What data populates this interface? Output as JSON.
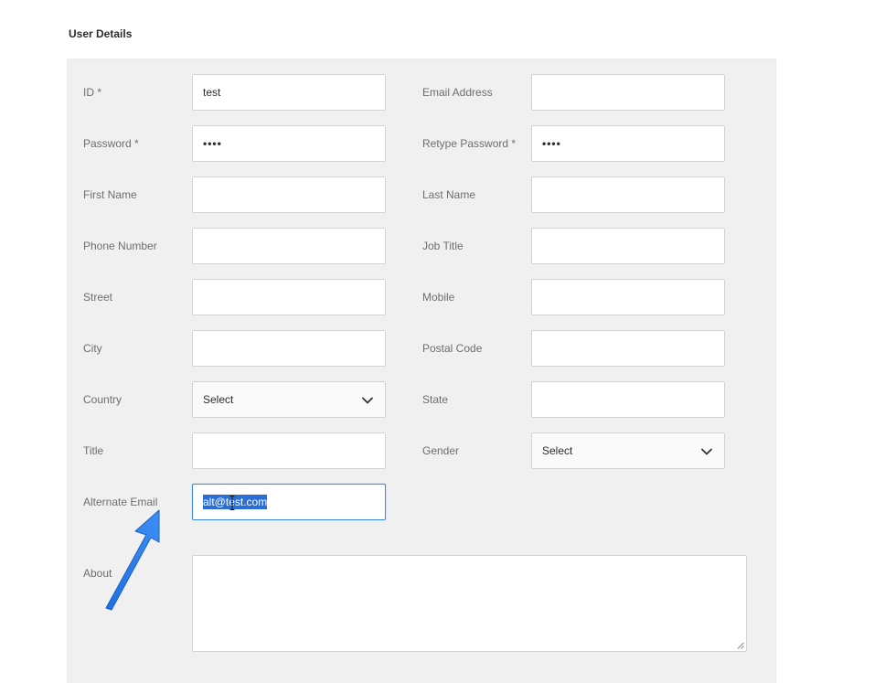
{
  "section": {
    "title": "User Details"
  },
  "fields": {
    "id": {
      "label": "ID *",
      "value": "test"
    },
    "email": {
      "label": "Email Address",
      "value": ""
    },
    "password": {
      "label": "Password *",
      "value": "••••"
    },
    "retype_password": {
      "label": "Retype Password *",
      "value": "••••"
    },
    "first_name": {
      "label": "First Name",
      "value": ""
    },
    "last_name": {
      "label": "Last Name",
      "value": ""
    },
    "phone": {
      "label": "Phone Number",
      "value": ""
    },
    "job_title": {
      "label": "Job Title",
      "value": ""
    },
    "street": {
      "label": "Street",
      "value": ""
    },
    "mobile": {
      "label": "Mobile",
      "value": ""
    },
    "city": {
      "label": "City",
      "value": ""
    },
    "postal_code": {
      "label": "Postal Code",
      "value": ""
    },
    "country": {
      "label": "Country",
      "value": "Select"
    },
    "state": {
      "label": "State",
      "value": ""
    },
    "title": {
      "label": "Title",
      "value": ""
    },
    "gender": {
      "label": "Gender",
      "value": "Select"
    },
    "alternate_email": {
      "label": "Alternate Email",
      "value": "alt@test.com"
    },
    "about": {
      "label": "About",
      "value": ""
    }
  },
  "icons": {
    "dropdown": "chevron-down-icon",
    "annotation": "arrow-annotation-icon",
    "cursor": "text-cursor-icon"
  },
  "colors": {
    "annotation_arrow": "#2f80ed",
    "selection": "#2b6fd6",
    "focus_border": "#3e8ad8",
    "panel_bg": "#f0f0f0"
  }
}
